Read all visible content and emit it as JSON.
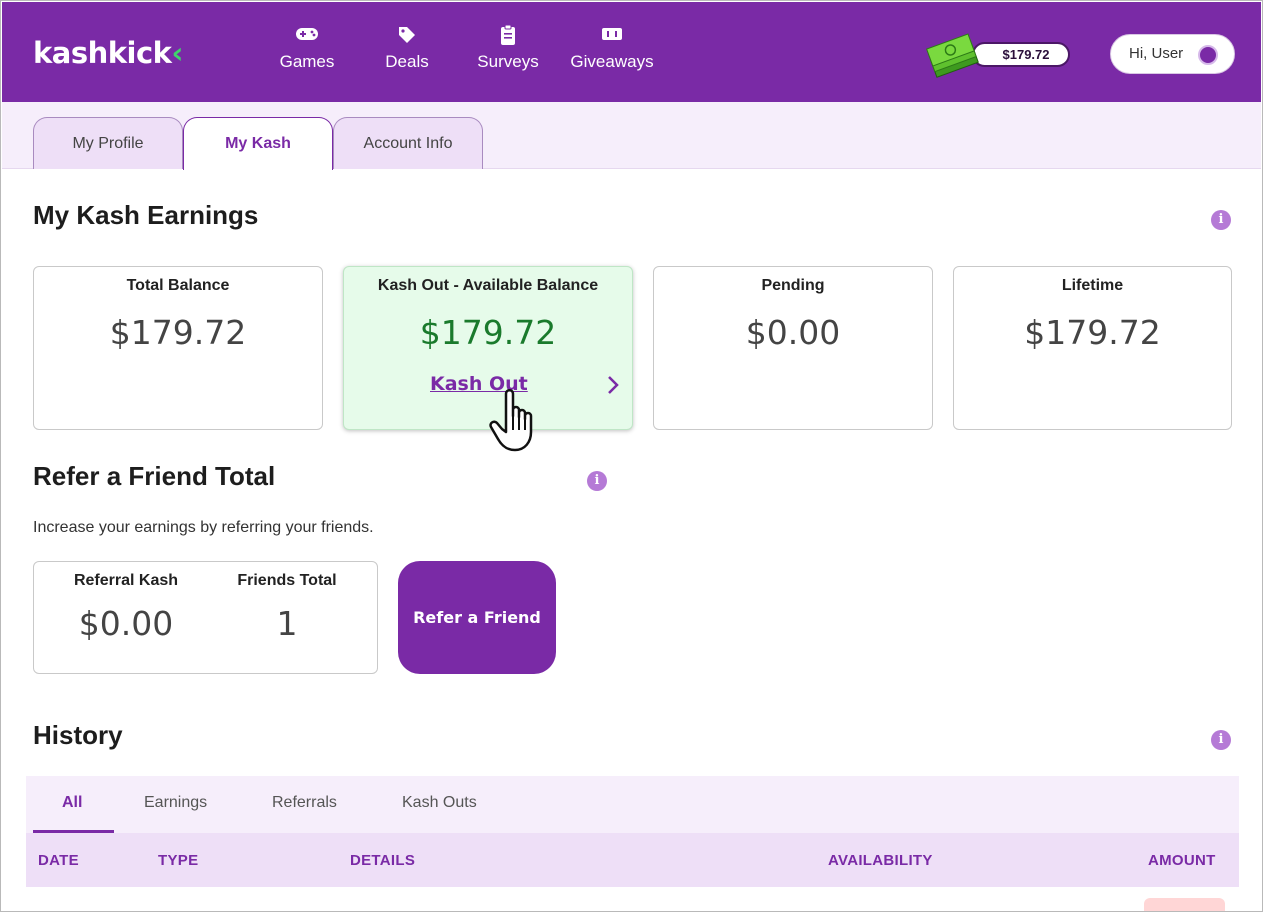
{
  "header": {
    "logo_text": "kashkick",
    "logo_chevron": "‹",
    "nav": [
      {
        "label": "Games",
        "icon": "gamepad-icon"
      },
      {
        "label": "Deals",
        "icon": "tags-icon"
      },
      {
        "label": "Surveys",
        "icon": "clipboard-icon"
      },
      {
        "label": "Giveaways",
        "icon": "ticket-icon"
      }
    ],
    "balance": "$179.72",
    "user_greeting": "Hi, User"
  },
  "profile_tabs": [
    {
      "label": "My Profile",
      "active": false
    },
    {
      "label": "My Kash",
      "active": true
    },
    {
      "label": "Account Info",
      "active": false
    }
  ],
  "earnings": {
    "title": "My Kash Earnings",
    "cards": [
      {
        "title": "Total Balance",
        "value": "$179.72"
      },
      {
        "title": "Kash Out - Available Balance",
        "value": "$179.72",
        "link": "Kash Out"
      },
      {
        "title": "Pending",
        "value": "$0.00"
      },
      {
        "title": "Lifetime",
        "value": "$179.72"
      }
    ]
  },
  "referral": {
    "title": "Refer a Friend Total",
    "subtext": "Increase your earnings by referring your friends.",
    "referral_kash_label": "Referral Kash",
    "referral_kash_value": "$0.00",
    "friends_total_label": "Friends Total",
    "friends_total_value": "1",
    "button": "Refer a Friend"
  },
  "history": {
    "title": "History",
    "tabs": [
      {
        "label": "All",
        "active": true
      },
      {
        "label": "Earnings",
        "active": false
      },
      {
        "label": "Referrals",
        "active": false
      },
      {
        "label": "Kash Outs",
        "active": false
      }
    ],
    "columns": [
      "DATE",
      "TYPE",
      "DETAILS",
      "AVAILABILITY",
      "AMOUNT"
    ]
  },
  "colors": {
    "brand_purple": "#7a2aa6",
    "accent_green": "#3fd36b",
    "available_green": "#1a7a2c"
  }
}
